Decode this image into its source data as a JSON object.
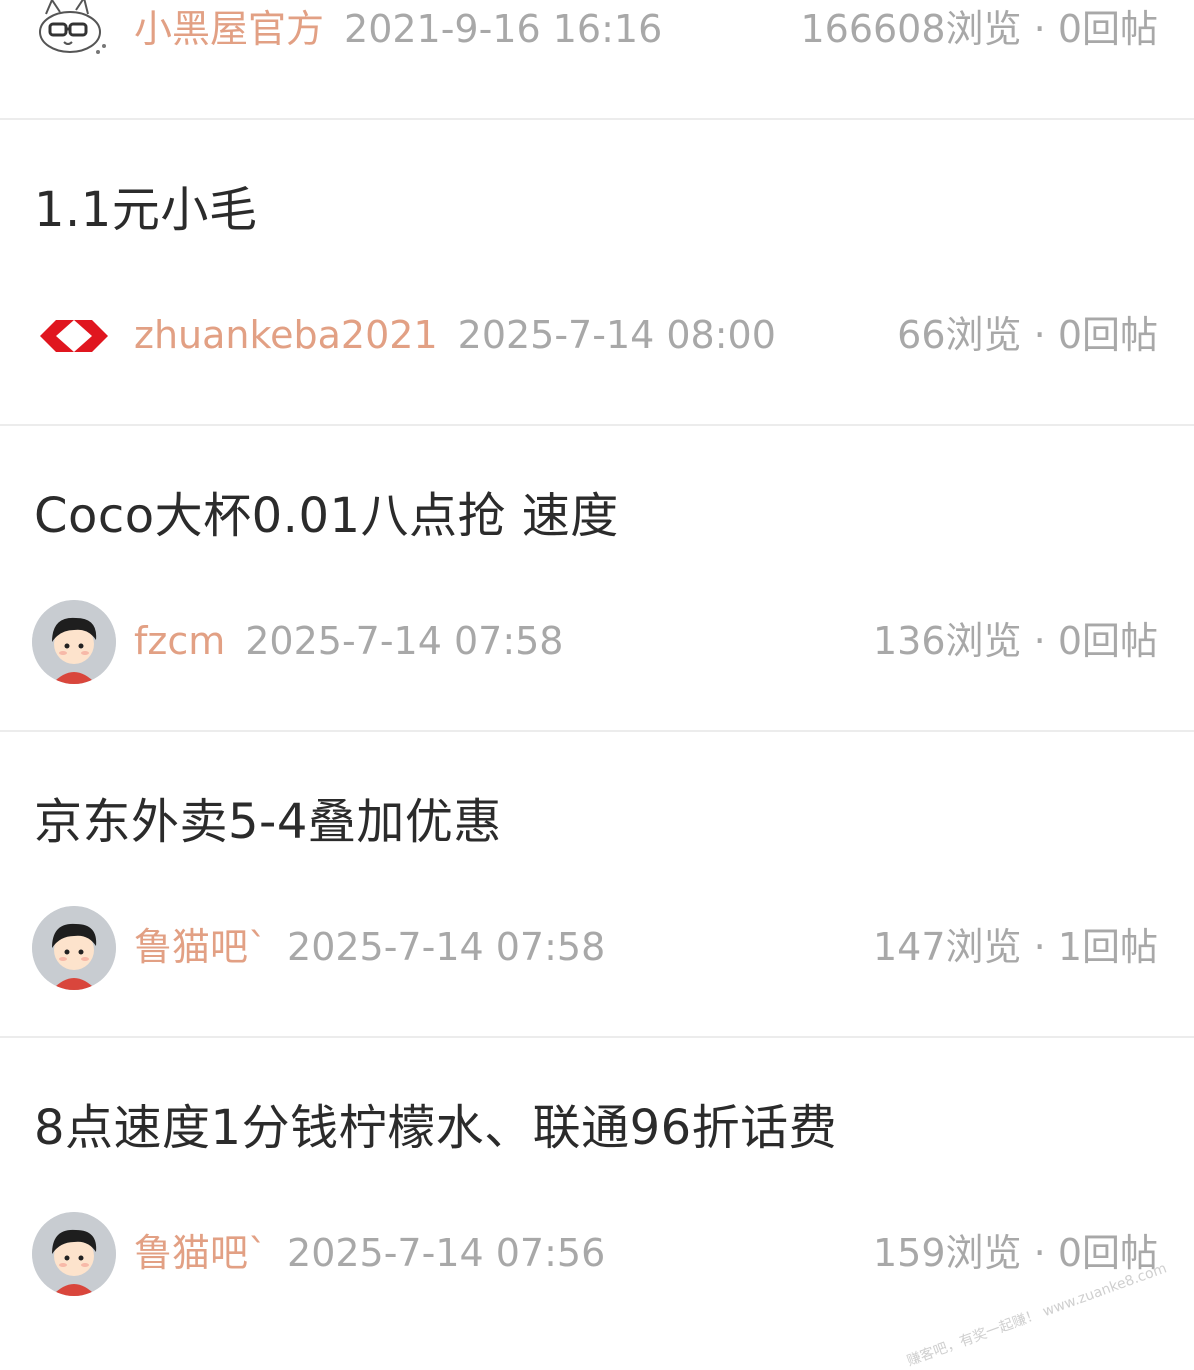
{
  "posts": [
    {
      "title": "",
      "author": "小黑屋官方",
      "time": "2021-9-16 16:16",
      "views": "166608浏览",
      "sep": "·",
      "replies": "0回帖",
      "avatar": "cat-glasses-avatar"
    },
    {
      "title": "1.1元小毛",
      "author": "zhuankeba2021",
      "time": "2025-7-14 08:00",
      "views": "66浏览",
      "sep": "·",
      "replies": "0回帖",
      "avatar": "red-hexagon-logo"
    },
    {
      "title": "Coco大杯0.01八点抢  速度",
      "author": "fzcm",
      "time": "2025-7-14 07:58",
      "views": "136浏览",
      "sep": "·",
      "replies": "0回帖",
      "avatar": "default-person-avatar"
    },
    {
      "title": "京东外卖5-4叠加优惠",
      "author": "鲁猫吧`",
      "time": "2025-7-14 07:58",
      "views": "147浏览",
      "sep": "·",
      "replies": "1回帖",
      "avatar": "default-person-avatar"
    },
    {
      "title": "8点速度1分钱柠檬水、联通96折话费",
      "author": "鲁猫吧`",
      "time": "2025-7-14 07:56",
      "views": "159浏览",
      "sep": "·",
      "replies": "0回帖",
      "avatar": "default-person-avatar"
    }
  ],
  "watermark": "赚客吧，有奖一起赚！ www.zuanke8.com",
  "colors": {
    "author": "#e2a084",
    "meta_gray": "#a8a8a8",
    "title": "#2b2b2b",
    "divider": "#ececec"
  }
}
